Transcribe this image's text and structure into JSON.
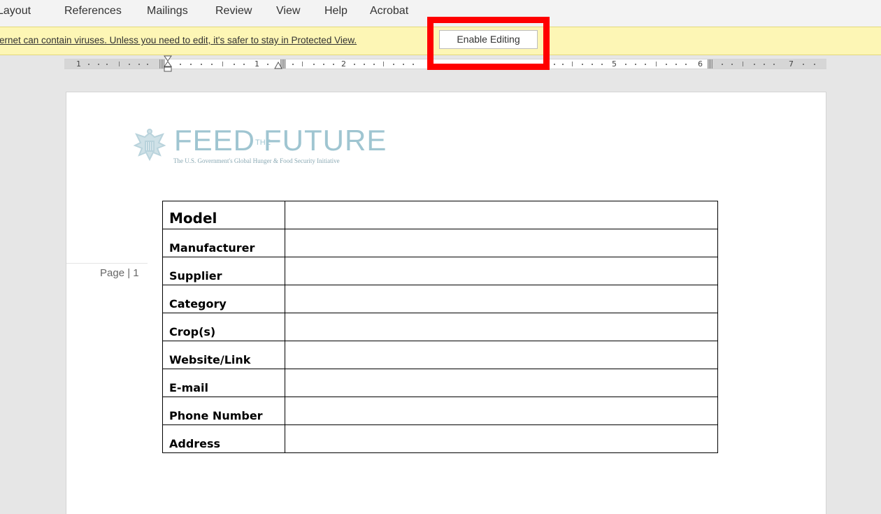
{
  "ribbon": {
    "tabs": [
      "Layout",
      "References",
      "Mailings",
      "Review",
      "View",
      "Help",
      "Acrobat"
    ]
  },
  "protected_view": {
    "message": "ernet can contain viruses. Unless you need to edit, it's safer to stay in Protected View.",
    "enable_button": "Enable Editing"
  },
  "ruler": {
    "numbers": [
      "1",
      "1",
      "2",
      "5",
      "6",
      "7"
    ]
  },
  "page": {
    "page_number": "Page | 1"
  },
  "logo": {
    "name_left": "FEED",
    "the": "THE",
    "name_right": "FUTURE",
    "tagline": "The U.S. Government's Global Hunger & Food Security Initiative"
  },
  "form": {
    "rows": [
      {
        "label": "Model",
        "value": ""
      },
      {
        "label": "Manufacturer",
        "value": ""
      },
      {
        "label": "Supplier",
        "value": ""
      },
      {
        "label": "Category",
        "value": ""
      },
      {
        "label": "Crop(s)",
        "value": ""
      },
      {
        "label": "Website/Link",
        "value": ""
      },
      {
        "label": "E-mail",
        "value": ""
      },
      {
        "label": "Phone Number",
        "value": ""
      },
      {
        "label": "Address",
        "value": ""
      }
    ]
  },
  "colors": {
    "highlight": "#ff0000",
    "message_bar": "#fdf6b5",
    "logo": "#9fc5d1"
  }
}
